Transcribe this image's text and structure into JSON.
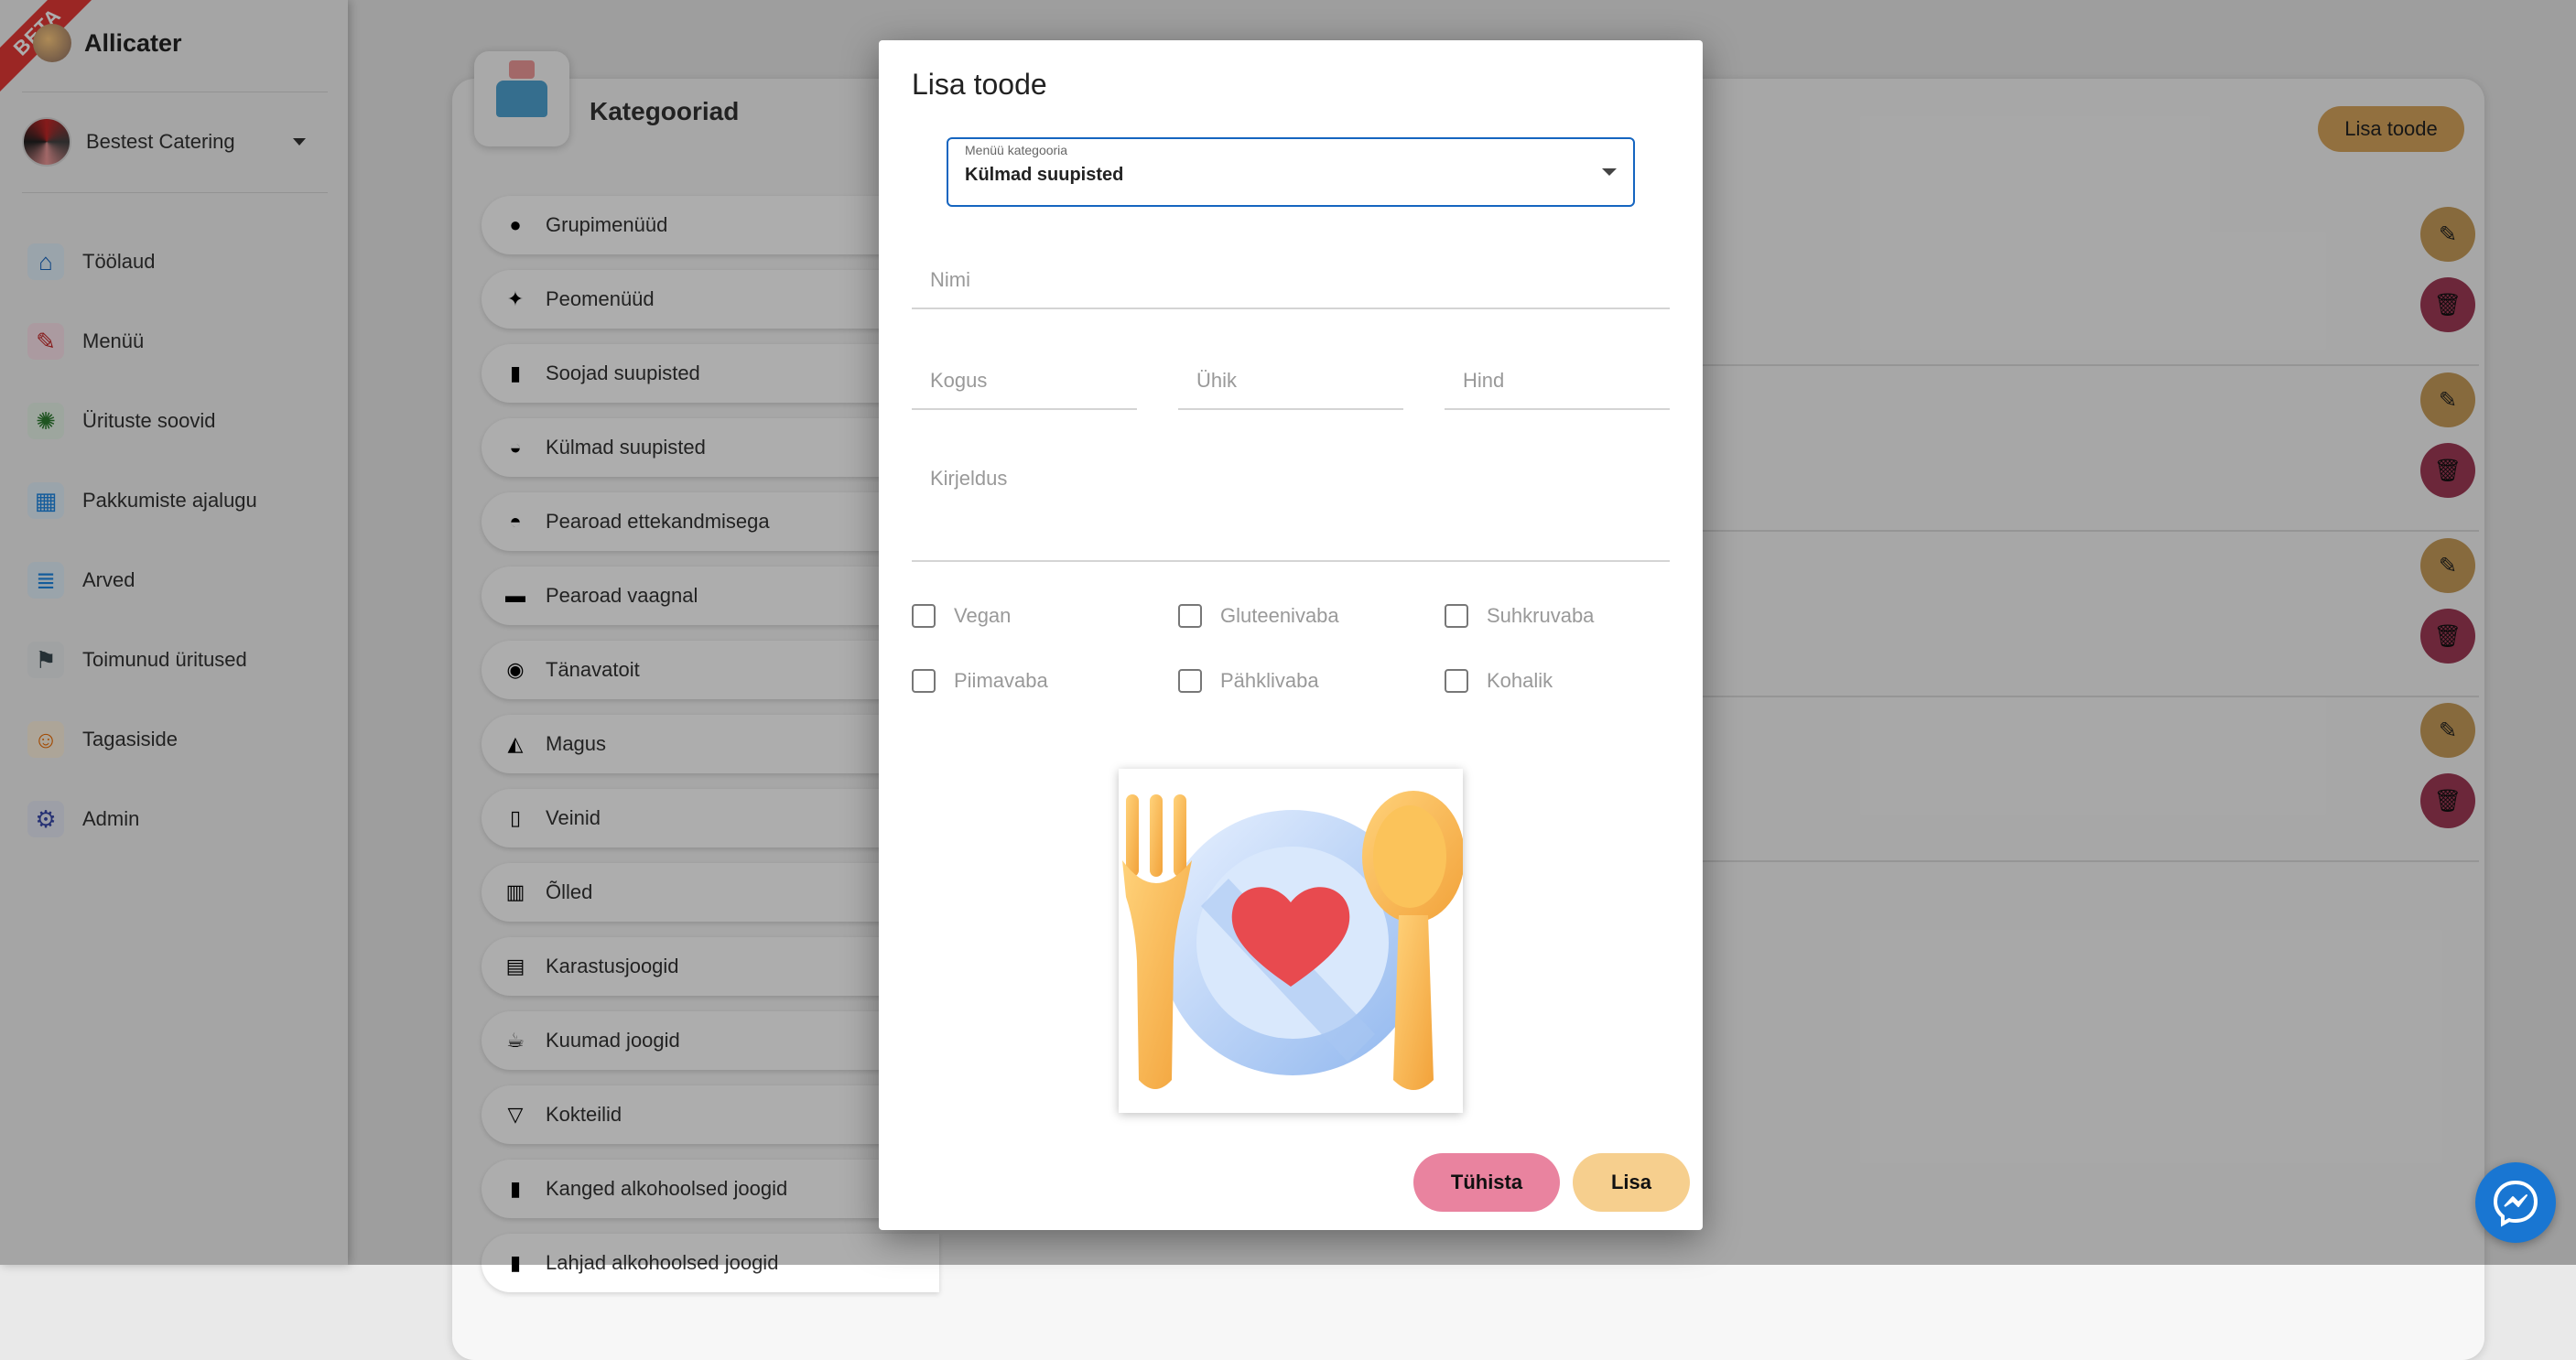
{
  "sidebar": {
    "beta_label": "BETA",
    "brand_name": "Allicater",
    "org_name": "Bestest Catering",
    "items": [
      {
        "label": "Töölaud"
      },
      {
        "label": "Menüü"
      },
      {
        "label": "Ürituste soovid"
      },
      {
        "label": "Pakkumiste ajalugu"
      },
      {
        "label": "Arved"
      },
      {
        "label": "Toimunud üritused"
      },
      {
        "label": "Tagasiside"
      },
      {
        "label": "Admin"
      }
    ]
  },
  "main": {
    "title": "Kategooriad",
    "add_button": "Lisa toode",
    "categories": [
      {
        "label": "Grupimenüüd"
      },
      {
        "label": "Peomenüüd"
      },
      {
        "label": "Soojad suupisted"
      },
      {
        "label": "Külmad suupisted"
      },
      {
        "label": "Pearoad ettekandmisega"
      },
      {
        "label": "Pearoad vaagnal"
      },
      {
        "label": "Tänavatoit"
      },
      {
        "label": "Magus"
      },
      {
        "label": "Veinid"
      },
      {
        "label": "Õlled"
      },
      {
        "label": "Karastusjoogid"
      },
      {
        "label": "Kuumad joogid"
      },
      {
        "label": "Kokteilid"
      },
      {
        "label": "Kanged alkohoolsed joogid"
      },
      {
        "label": "Lahjad alkohoolsed joogid"
      }
    ]
  },
  "modal": {
    "title": "Lisa toode",
    "category_select": {
      "label": "Menüü kategooria",
      "value": "Külmad suupisted"
    },
    "fields": {
      "name": "Nimi",
      "quantity": "Kogus",
      "unit": "Ühik",
      "price": "Hind",
      "description": "Kirjeldus"
    },
    "checkboxes": [
      {
        "label": "Vegan"
      },
      {
        "label": "Gluteenivaba"
      },
      {
        "label": "Suhkruvaba"
      },
      {
        "label": "Piimavaba"
      },
      {
        "label": "Pähklivaba"
      },
      {
        "label": "Kohalik"
      }
    ],
    "cancel_label": "Tühista",
    "add_label": "Lisa"
  }
}
